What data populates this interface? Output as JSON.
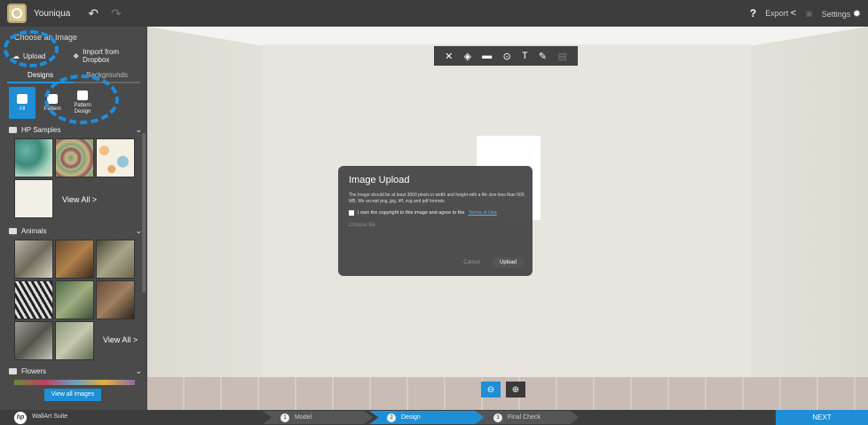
{
  "topbar": {
    "brand": "Youniqua",
    "undo_glyph": "↶",
    "redo_glyph": "↷",
    "help": "?",
    "export": "Export",
    "settings": "Settings"
  },
  "sidebar": {
    "title": "Choose an Image",
    "upload": "Upload",
    "dropbox": "Import from Dropbox",
    "tabs": [
      "Designs",
      "Backgrounds"
    ],
    "categories": [
      "All",
      "Pattern",
      "Pattern Design"
    ],
    "sections": [
      {
        "title": "HP Samples",
        "view_all": "View All  >"
      },
      {
        "title": "Animals",
        "view_all": "View All  >"
      },
      {
        "title": "Flowers"
      }
    ],
    "view_all_images": "View all images"
  },
  "toolbar": {
    "icons": [
      "✕",
      "◈",
      "▬",
      "⊙",
      "T",
      "✎",
      "▤"
    ]
  },
  "dialog": {
    "title": "Image Upload",
    "body": "The image should be at least 3000 pixels in width and height with a file size less than 500 MB. We accept png, jpg, tiff, svg and pdf formats.",
    "agree": "I own the copyright to this image and agree to the",
    "terms": "Terms of Use",
    "choose": "Choose file",
    "cancel": "Cancel",
    "upload": "Upload"
  },
  "zoom": {
    "in": "⊖",
    "out": "⊕"
  },
  "bottom": {
    "hp": "hp",
    "suite": "WallArt Suite",
    "steps": [
      {
        "num": "1",
        "label": "Model"
      },
      {
        "num": "2",
        "label": "Design"
      },
      {
        "num": "3",
        "label": "Final Check"
      }
    ],
    "next": "NEXT"
  },
  "colors": {
    "accent": "#1e8fd6",
    "dark": "#3d3d3d",
    "sidebar": "#4a4a4a"
  }
}
